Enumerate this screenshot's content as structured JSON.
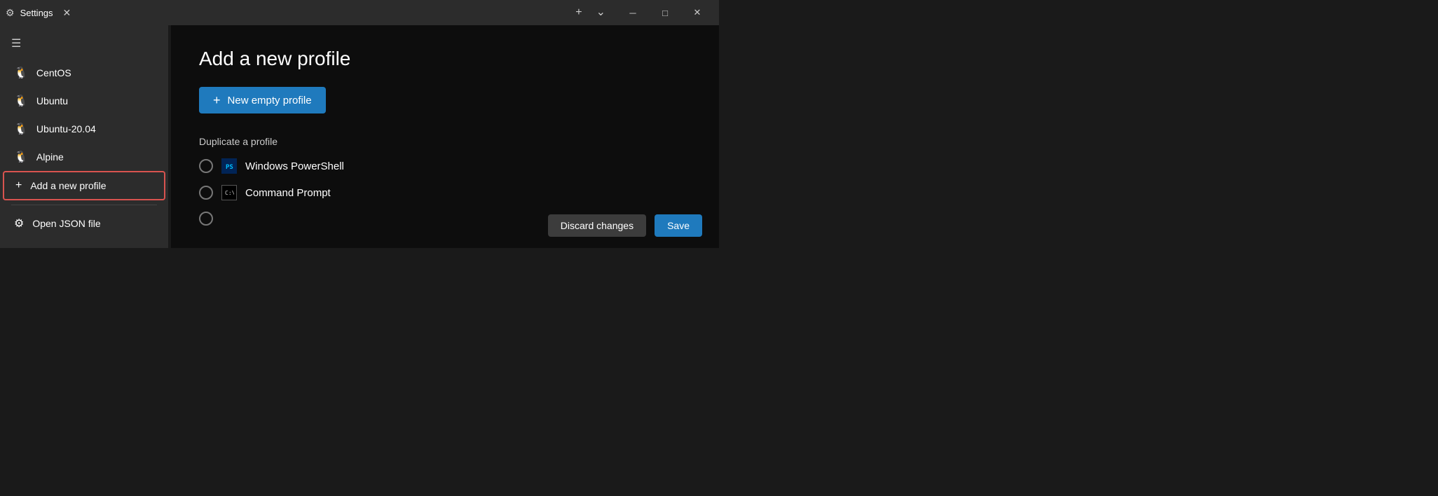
{
  "titleBar": {
    "icon": "⚙",
    "title": "Settings",
    "closeLabel": "✕",
    "addTabLabel": "+",
    "dropdownLabel": "⌄",
    "minimizeLabel": "─",
    "maximizeLabel": "□",
    "winCloseLabel": "✕"
  },
  "sidebar": {
    "hamburgerIcon": "☰",
    "items": [
      {
        "id": "centos",
        "icon": "🐧",
        "label": "CentOS"
      },
      {
        "id": "ubuntu",
        "icon": "🐧",
        "label": "Ubuntu"
      },
      {
        "id": "ubuntu2004",
        "icon": "🐧",
        "label": "Ubuntu-20.04"
      },
      {
        "id": "alpine",
        "icon": "🐧",
        "label": "Alpine"
      }
    ],
    "addProfileLabel": "Add a new profile",
    "addIcon": "+",
    "jsonLabel": "Open JSON file",
    "jsonIcon": "⚙"
  },
  "content": {
    "title": "Add a new profile",
    "newProfileButtonLabel": "New empty profile",
    "newProfilePlusIcon": "+",
    "duplicateLabel": "Duplicate a profile",
    "profiles": [
      {
        "id": "powershell",
        "name": "Windows PowerShell",
        "iconType": "ps"
      },
      {
        "id": "cmd",
        "name": "Command Prompt",
        "iconType": "cmd"
      }
    ],
    "discardLabel": "Discard changes",
    "saveLabel": "Save"
  }
}
